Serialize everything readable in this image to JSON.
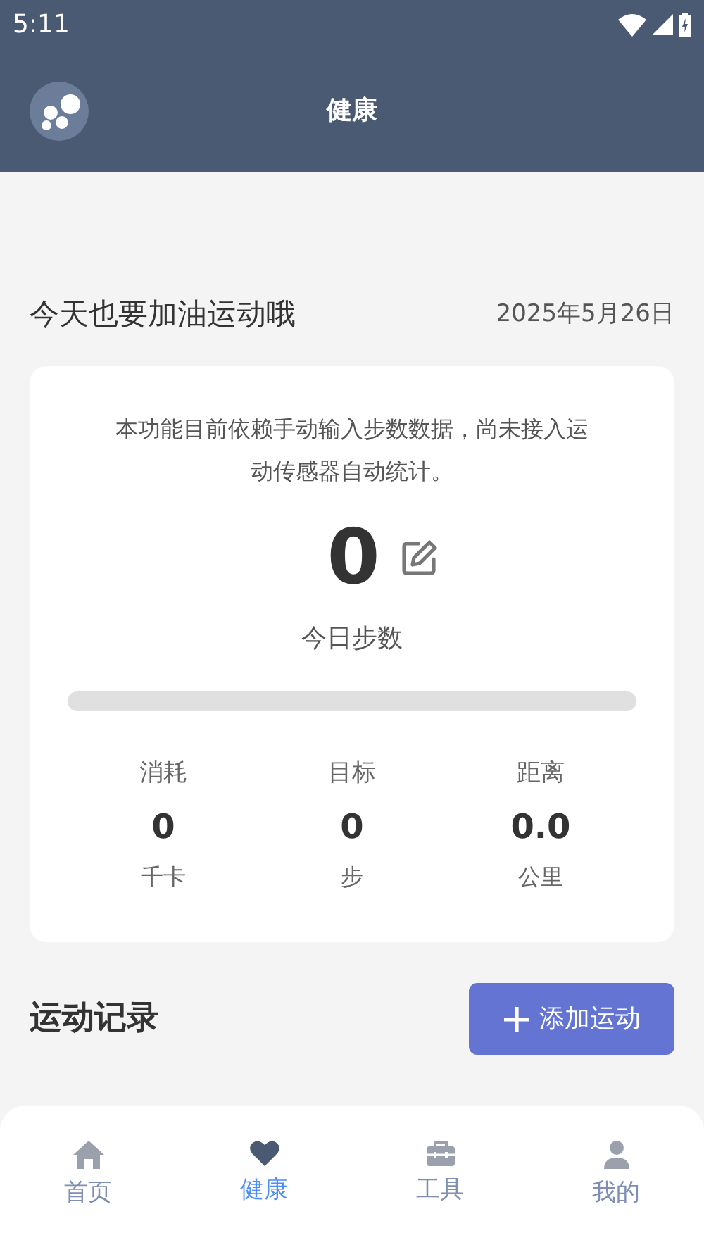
{
  "status_bar": {
    "time": "5:11"
  },
  "header": {
    "title": "健康"
  },
  "greeting": {
    "text": "今天也要加油运动哦",
    "date": "2025年5月26日"
  },
  "steps_card": {
    "notice": "本功能目前依赖手动输入步数数据，尚未接入运动传感器自动统计。",
    "steps": "0",
    "steps_label": "今日步数",
    "level": 0,
    "stats": [
      {
        "label": "消耗",
        "value": "0",
        "unit": "千卡"
      },
      {
        "label": "目标",
        "value": "0",
        "unit": "步"
      },
      {
        "label": "距离",
        "value": "0.0",
        "unit": "公里"
      }
    ]
  },
  "records": {
    "title": "运动记录",
    "add_button": "添加运动"
  },
  "tabs": [
    {
      "kind": "home",
      "label": "首页",
      "selected": false
    },
    {
      "kind": "health",
      "label": "健康",
      "selected": true
    },
    {
      "kind": "tools",
      "label": "工具",
      "selected": false
    },
    {
      "kind": "profile",
      "label": "我的",
      "selected": false
    }
  ]
}
